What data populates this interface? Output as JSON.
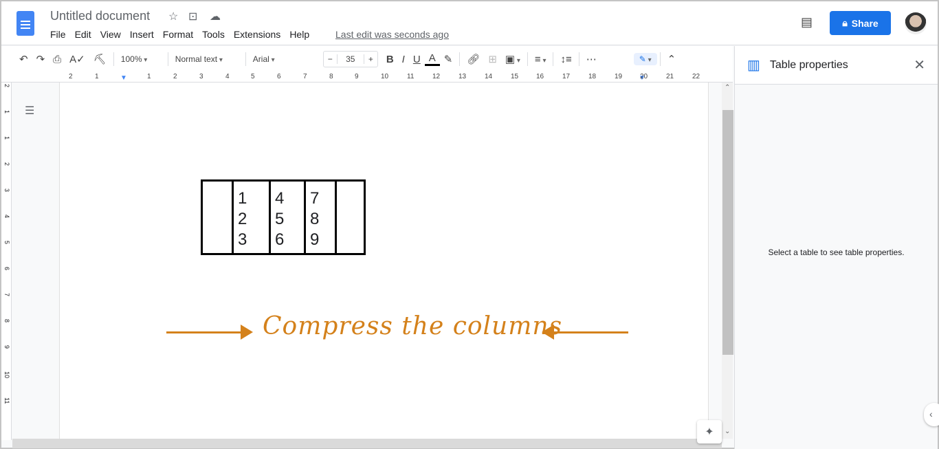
{
  "header": {
    "title": "Untitled document",
    "menu": [
      "File",
      "Edit",
      "View",
      "Insert",
      "Format",
      "Tools",
      "Extensions",
      "Help"
    ],
    "last_edit": "Last edit was seconds ago",
    "share_label": "Share"
  },
  "toolbar": {
    "zoom": "100%",
    "style": "Normal text",
    "font": "Arial",
    "font_size": "35",
    "minus": "−",
    "plus": "+",
    "bold": "B",
    "italic": "I",
    "underline": "U",
    "text_color": "A",
    "more": "⋯"
  },
  "ruler": {
    "h": [
      "2",
      "1",
      "1",
      "2",
      "3",
      "4",
      "5",
      "6",
      "7",
      "8",
      "9",
      "10",
      "11",
      "12",
      "13",
      "14",
      "15",
      "16",
      "17",
      "18",
      "19",
      "20",
      "21",
      "22"
    ],
    "v": [
      "2",
      "1",
      "1",
      "2",
      "3",
      "4",
      "5",
      "6",
      "7",
      "8",
      "9",
      "10",
      "11"
    ]
  },
  "table": {
    "rows": [
      [
        "",
        "1\n2\n3",
        "4\n5\n6",
        "7\n8\n9",
        ""
      ]
    ]
  },
  "annotation": {
    "text": "Compress the columns",
    "color": "#d4811b"
  },
  "panel": {
    "title": "Table properties",
    "message": "Select a table to see table properties."
  },
  "colors": {
    "accent": "#1a73e8"
  }
}
